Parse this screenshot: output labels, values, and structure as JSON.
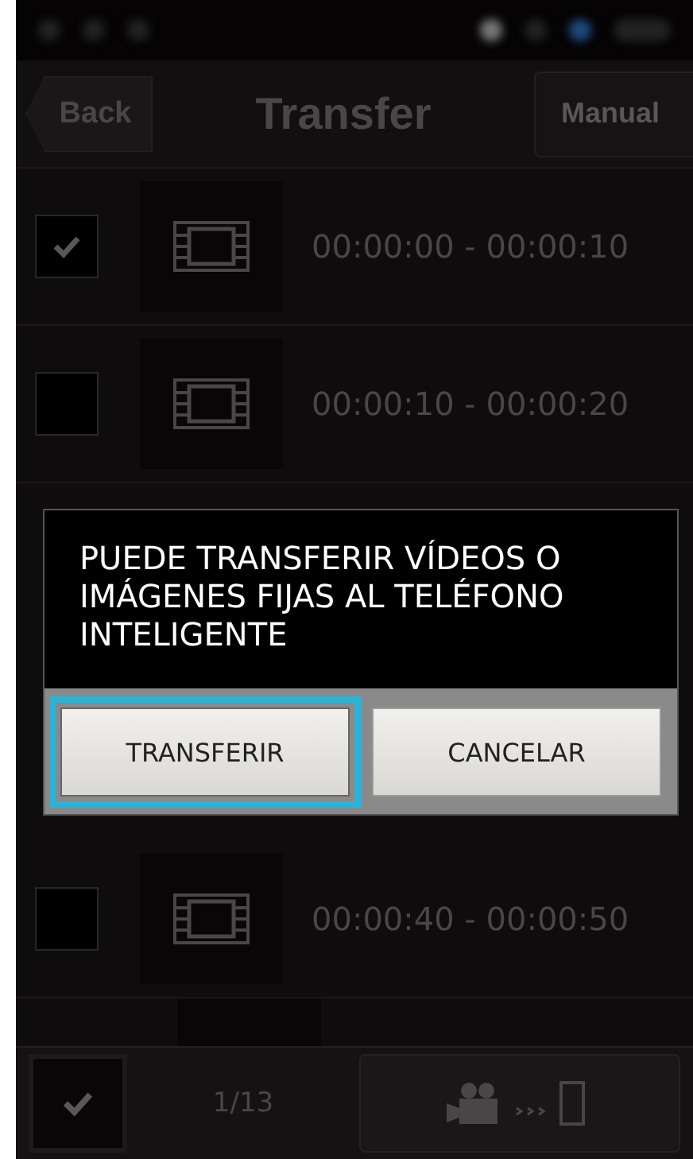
{
  "header": {
    "back": "Back",
    "title": "Transfer",
    "right_button": "Manual"
  },
  "rows_above": [
    {
      "time": "00:00:00 - 00:00:10",
      "checked": true
    },
    {
      "time": "00:00:10 - 00:00:20",
      "checked": false
    }
  ],
  "dialog": {
    "message": "PUEDE TRANSFERIR VÍDEOS O IMÁGENES FIJAS AL TELÉFONO INTELIGENTE",
    "buttons": [
      {
        "label": "TRANSFERIR",
        "selected": true
      },
      {
        "label": "CANCELAR",
        "selected": false
      }
    ]
  },
  "rows_below": [
    {
      "time": "00:00:40 - 00:00:50",
      "checked": false
    }
  ],
  "bottom_bar": {
    "select_all_checked": true,
    "count": "1/13"
  }
}
